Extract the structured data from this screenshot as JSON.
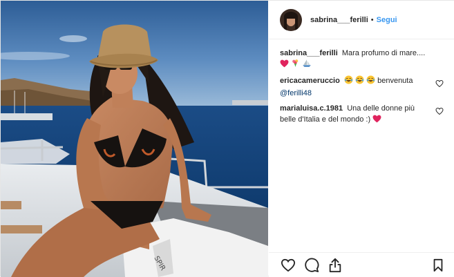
{
  "post": {
    "author": {
      "username": "sabrina___ferilli",
      "separator": "•",
      "follow_label": "Segui"
    },
    "comments": [
      {
        "username": "sabrina___ferilli",
        "text": "Mara profumo di mare....",
        "emojis": [
          "red-heart",
          "bouquet",
          "sailboat"
        ]
      },
      {
        "username": "ericacameruccio",
        "text": "benvenuta",
        "emojis": [
          "tears-of-joy",
          "tears-of-joy",
          "tears-of-joy"
        ],
        "mention": "@ferilli48"
      },
      {
        "username": "marialuisa.c.1981",
        "text": "Una delle donne più belle d'Italia e del mondo :)",
        "emojis": [
          "red-heart"
        ]
      }
    ],
    "actions": [
      "like-icon",
      "comment-icon",
      "share-icon",
      "bookmark-icon"
    ],
    "colors": {
      "follow": "#3897f0",
      "mention": "#003569",
      "text": "#262626",
      "border": "#efefef",
      "heart": "#ed4956"
    }
  }
}
